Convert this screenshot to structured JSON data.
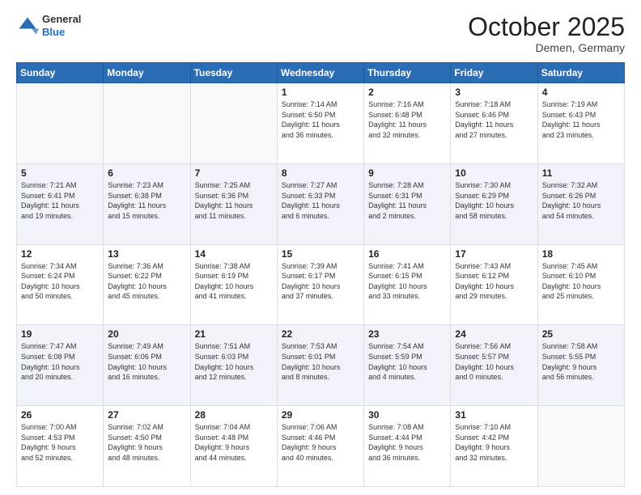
{
  "header": {
    "logo_general": "General",
    "logo_blue": "Blue",
    "month_title": "October 2025",
    "location": "Demen, Germany"
  },
  "days_of_week": [
    "Sunday",
    "Monday",
    "Tuesday",
    "Wednesday",
    "Thursday",
    "Friday",
    "Saturday"
  ],
  "weeks": [
    [
      {
        "day": "",
        "info": ""
      },
      {
        "day": "",
        "info": ""
      },
      {
        "day": "",
        "info": ""
      },
      {
        "day": "1",
        "info": "Sunrise: 7:14 AM\nSunset: 6:50 PM\nDaylight: 11 hours\nand 36 minutes."
      },
      {
        "day": "2",
        "info": "Sunrise: 7:16 AM\nSunset: 6:48 PM\nDaylight: 11 hours\nand 32 minutes."
      },
      {
        "day": "3",
        "info": "Sunrise: 7:18 AM\nSunset: 6:46 PM\nDaylight: 11 hours\nand 27 minutes."
      },
      {
        "day": "4",
        "info": "Sunrise: 7:19 AM\nSunset: 6:43 PM\nDaylight: 11 hours\nand 23 minutes."
      }
    ],
    [
      {
        "day": "5",
        "info": "Sunrise: 7:21 AM\nSunset: 6:41 PM\nDaylight: 11 hours\nand 19 minutes."
      },
      {
        "day": "6",
        "info": "Sunrise: 7:23 AM\nSunset: 6:38 PM\nDaylight: 11 hours\nand 15 minutes."
      },
      {
        "day": "7",
        "info": "Sunrise: 7:25 AM\nSunset: 6:36 PM\nDaylight: 11 hours\nand 11 minutes."
      },
      {
        "day": "8",
        "info": "Sunrise: 7:27 AM\nSunset: 6:33 PM\nDaylight: 11 hours\nand 6 minutes."
      },
      {
        "day": "9",
        "info": "Sunrise: 7:28 AM\nSunset: 6:31 PM\nDaylight: 11 hours\nand 2 minutes."
      },
      {
        "day": "10",
        "info": "Sunrise: 7:30 AM\nSunset: 6:29 PM\nDaylight: 10 hours\nand 58 minutes."
      },
      {
        "day": "11",
        "info": "Sunrise: 7:32 AM\nSunset: 6:26 PM\nDaylight: 10 hours\nand 54 minutes."
      }
    ],
    [
      {
        "day": "12",
        "info": "Sunrise: 7:34 AM\nSunset: 6:24 PM\nDaylight: 10 hours\nand 50 minutes."
      },
      {
        "day": "13",
        "info": "Sunrise: 7:36 AM\nSunset: 6:22 PM\nDaylight: 10 hours\nand 45 minutes."
      },
      {
        "day": "14",
        "info": "Sunrise: 7:38 AM\nSunset: 6:19 PM\nDaylight: 10 hours\nand 41 minutes."
      },
      {
        "day": "15",
        "info": "Sunrise: 7:39 AM\nSunset: 6:17 PM\nDaylight: 10 hours\nand 37 minutes."
      },
      {
        "day": "16",
        "info": "Sunrise: 7:41 AM\nSunset: 6:15 PM\nDaylight: 10 hours\nand 33 minutes."
      },
      {
        "day": "17",
        "info": "Sunrise: 7:43 AM\nSunset: 6:12 PM\nDaylight: 10 hours\nand 29 minutes."
      },
      {
        "day": "18",
        "info": "Sunrise: 7:45 AM\nSunset: 6:10 PM\nDaylight: 10 hours\nand 25 minutes."
      }
    ],
    [
      {
        "day": "19",
        "info": "Sunrise: 7:47 AM\nSunset: 6:08 PM\nDaylight: 10 hours\nand 20 minutes."
      },
      {
        "day": "20",
        "info": "Sunrise: 7:49 AM\nSunset: 6:06 PM\nDaylight: 10 hours\nand 16 minutes."
      },
      {
        "day": "21",
        "info": "Sunrise: 7:51 AM\nSunset: 6:03 PM\nDaylight: 10 hours\nand 12 minutes."
      },
      {
        "day": "22",
        "info": "Sunrise: 7:53 AM\nSunset: 6:01 PM\nDaylight: 10 hours\nand 8 minutes."
      },
      {
        "day": "23",
        "info": "Sunrise: 7:54 AM\nSunset: 5:59 PM\nDaylight: 10 hours\nand 4 minutes."
      },
      {
        "day": "24",
        "info": "Sunrise: 7:56 AM\nSunset: 5:57 PM\nDaylight: 10 hours\nand 0 minutes."
      },
      {
        "day": "25",
        "info": "Sunrise: 7:58 AM\nSunset: 5:55 PM\nDaylight: 9 hours\nand 56 minutes."
      }
    ],
    [
      {
        "day": "26",
        "info": "Sunrise: 7:00 AM\nSunset: 4:53 PM\nDaylight: 9 hours\nand 52 minutes."
      },
      {
        "day": "27",
        "info": "Sunrise: 7:02 AM\nSunset: 4:50 PM\nDaylight: 9 hours\nand 48 minutes."
      },
      {
        "day": "28",
        "info": "Sunrise: 7:04 AM\nSunset: 4:48 PM\nDaylight: 9 hours\nand 44 minutes."
      },
      {
        "day": "29",
        "info": "Sunrise: 7:06 AM\nSunset: 4:46 PM\nDaylight: 9 hours\nand 40 minutes."
      },
      {
        "day": "30",
        "info": "Sunrise: 7:08 AM\nSunset: 4:44 PM\nDaylight: 9 hours\nand 36 minutes."
      },
      {
        "day": "31",
        "info": "Sunrise: 7:10 AM\nSunset: 4:42 PM\nDaylight: 9 hours\nand 32 minutes."
      },
      {
        "day": "",
        "info": ""
      }
    ]
  ]
}
